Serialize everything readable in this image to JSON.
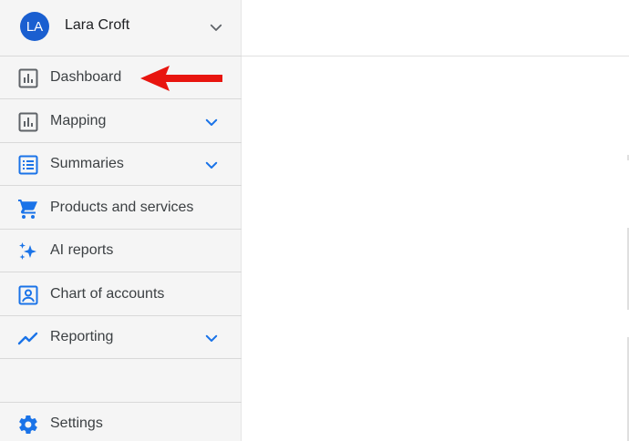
{
  "user": {
    "initials": "LA",
    "name": "Lara Croft",
    "avatar_color": "#1a5fd0"
  },
  "sidebar": {
    "items": [
      {
        "label": "Dashboard",
        "icon": "bar-chart-icon",
        "has_chevron": false,
        "selected": true
      },
      {
        "label": "Mapping",
        "icon": "bar-chart-icon",
        "has_chevron": true
      },
      {
        "label": "Summaries",
        "icon": "list-icon",
        "has_chevron": true
      },
      {
        "label": "Products and services",
        "icon": "shopping-cart-icon",
        "has_chevron": false
      },
      {
        "label": "AI reports",
        "icon": "sparkle-icon",
        "has_chevron": false
      },
      {
        "label": "Chart of accounts",
        "icon": "contact-card-icon",
        "has_chevron": false
      },
      {
        "label": "Reporting",
        "icon": "trending-up-icon",
        "has_chevron": true
      }
    ],
    "footer": {
      "label": "Settings",
      "icon": "gear-icon"
    }
  },
  "colors": {
    "accent": "#1a73e8",
    "gray_icon": "#5f6368",
    "annotation_arrow": "#e8150f",
    "sidebar_bg": "#f5f5f5"
  }
}
